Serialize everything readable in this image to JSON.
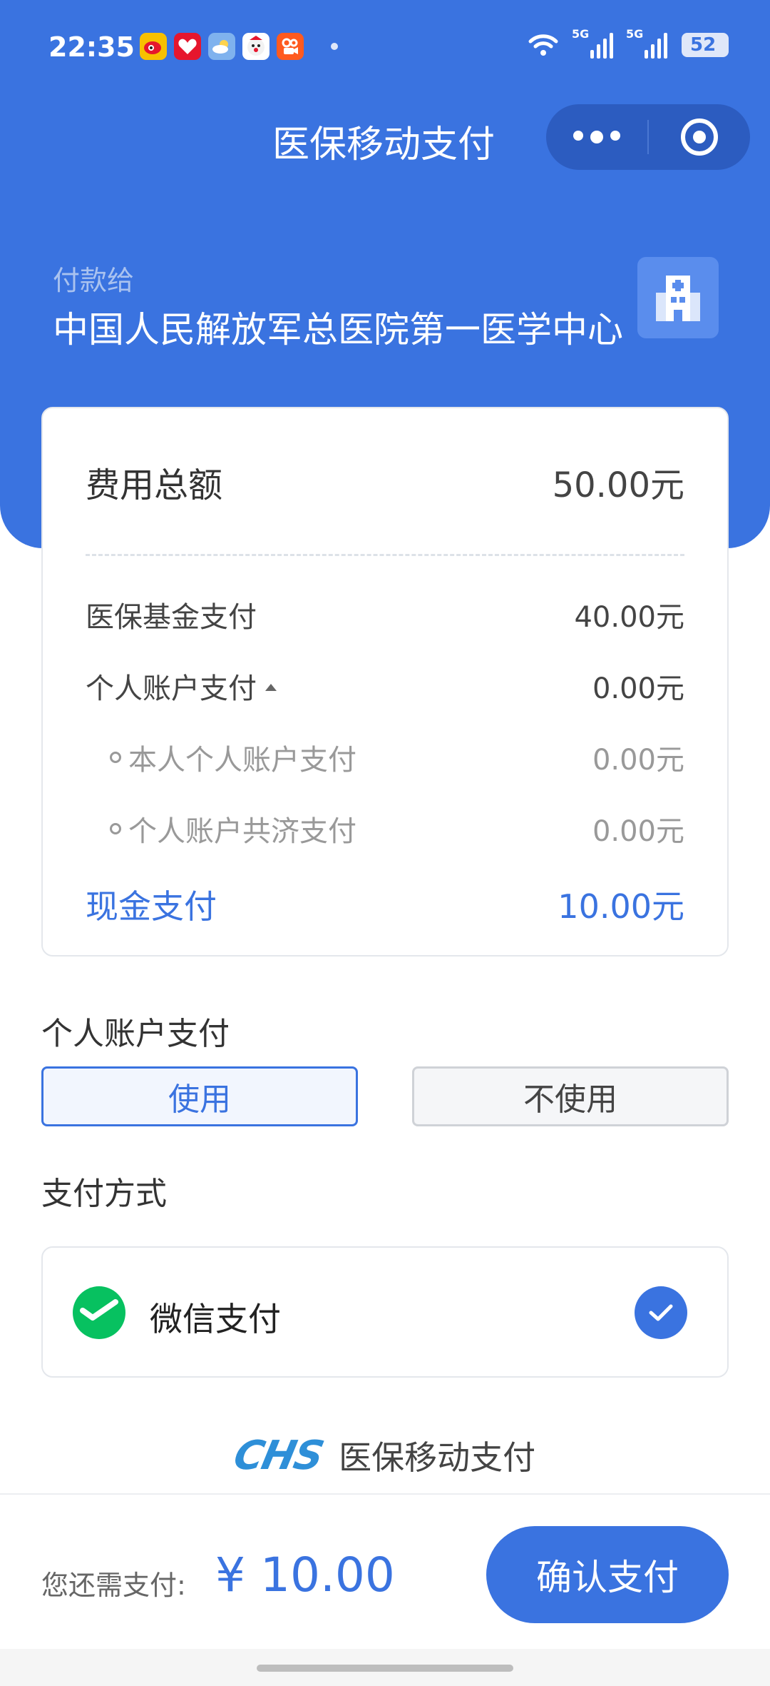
{
  "status_bar": {
    "time": "22:35",
    "battery": "52",
    "network_tag_1": "5G",
    "network_tag_2": "5G"
  },
  "nav": {
    "title": "医保移动支付"
  },
  "payee": {
    "label": "付款给",
    "name": "中国人民解放军总医院第一医学中心"
  },
  "summary": {
    "total_label": "费用总额",
    "total_value": "50.00元",
    "fund_label": "医保基金支付",
    "fund_value": "40.00元",
    "personal_label": "个人账户支付",
    "personal_value": "0.00元",
    "self_label": "本人个人账户支付",
    "self_value": "0.00元",
    "mutual_label": "个人账户共济支付",
    "mutual_value": "0.00元",
    "cash_label": "现金支付",
    "cash_value": "10.00元"
  },
  "personal_account": {
    "title": "个人账户支付",
    "use_label": "使用",
    "not_use_label": "不使用",
    "selected": "使用"
  },
  "payment_method": {
    "title": "支付方式",
    "option_label": "微信支付",
    "selected": true
  },
  "brand": {
    "logo_text": "CHS",
    "text": "医保移动支付"
  },
  "footer": {
    "due_label": "您还需支付:",
    "due_value": "¥ 10.00",
    "confirm_label": "确认支付"
  },
  "colors": {
    "primary": "#3a73e0",
    "wechat_green": "#07c160"
  }
}
